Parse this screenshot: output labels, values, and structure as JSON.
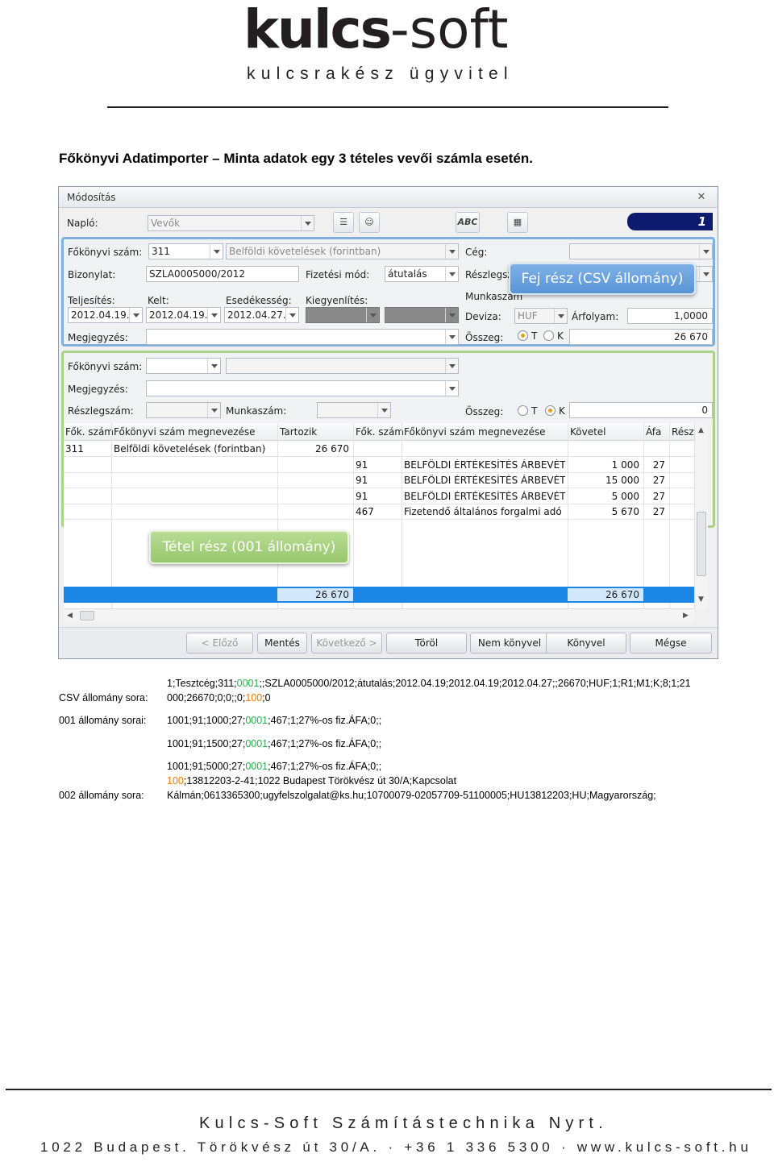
{
  "logo": {
    "brand_bold": "kulcs",
    "brand_light": "-soft",
    "tagline": "kulcsrakész ügyvitel"
  },
  "doc_title": "Főkönyvi Adatimporter – Minta adatok egy 3 tételes vevői számla esetén.",
  "window": {
    "title": "Módosítás",
    "naplo_label": "Napló:",
    "naplo_value": "Vevők",
    "abc_label": "ABC",
    "counter": "1",
    "header": {
      "fokonyvi_szam_label": "Főkönyvi szám:",
      "fokonyvi_szam_value": "311",
      "fokonyvi_szam_name": "Belföldi követelések (forintban)",
      "ceg_label": "Cég:",
      "ceg_value": "",
      "bizonylat_label": "Bizonylat:",
      "bizonylat_value": "SZLA0005000/2012",
      "fizetesi_mod_label": "Fizetési mód:",
      "fizetesi_mod_value": "átutalás",
      "reszlegszam_label": "Részlegsz",
      "teljesites_label": "Teljesítés:",
      "teljesites_value": "2012.04.19.",
      "kelt_label": "Kelt:",
      "kelt_value": "2012.04.19.",
      "esedekesseg_label": "Esedékesség:",
      "esedekesseg_value": "2012.04.27.",
      "kiegyenlites_label": "Kiegyenlítés:",
      "munkaszam_label": "Munkaszám",
      "deviza_label": "Deviza:",
      "deviza_value": "HUF",
      "arfolyam_label": "Árfolyam:",
      "arfolyam_value": "1,0000",
      "megjegyzes_label": "Megjegyzés:",
      "osszeg_label": "Összeg:",
      "osszeg_value": "26 670",
      "radio_t": "T",
      "radio_k": "K"
    },
    "item": {
      "fokonyvi_szam_label": "Főkönyvi szám:",
      "megjegyzes_label": "Megjegyzés:",
      "reszlegszam_label": "Részlegszám:",
      "munkaszam_label": "Munkaszám:",
      "osszeg_label": "Összeg:",
      "osszeg_value": "0",
      "radio_t": "T",
      "radio_k": "K"
    },
    "grid": {
      "columns": [
        "Fők. szám",
        "Főkönyvi szám megnevezése",
        "Tartozik",
        "Fők. szám",
        "Főkönyvi szám megnevezése",
        "Követel",
        "Áfa",
        "Rész"
      ],
      "rows": [
        {
          "fsz1": "311",
          "nev1": "Belföldi követelések (forintban)",
          "tartozik": "26 670",
          "fsz2": "",
          "nev2": "",
          "kovetel": "",
          "afa": ""
        },
        {
          "fsz1": "",
          "nev1": "",
          "tartozik": "",
          "fsz2": "91",
          "nev2": "BELFÖLDI ÉRTÉKESÍTÉS ÁRBEVÉTELE",
          "kovetel": "1 000",
          "afa": "27"
        },
        {
          "fsz1": "",
          "nev1": "",
          "tartozik": "",
          "fsz2": "91",
          "nev2": "BELFÖLDI ÉRTÉKESÍTÉS ÁRBEVÉTELE",
          "kovetel": "15 000",
          "afa": "27"
        },
        {
          "fsz1": "",
          "nev1": "",
          "tartozik": "",
          "fsz2": "91",
          "nev2": "BELFÖLDI ÉRTÉKESÍTÉS ÁRBEVÉTELE",
          "kovetel": "5 000",
          "afa": "27"
        },
        {
          "fsz1": "",
          "nev1": "",
          "tartozik": "",
          "fsz2": "467",
          "nev2": "Fizetendő általános forgalmi adó",
          "kovetel": "5 670",
          "afa": "27"
        }
      ],
      "sum_tartozik": "26 670",
      "sum_kovetel": "26 670"
    },
    "buttons": [
      "< Előző",
      "Mentés",
      "Következő >",
      "Töröl",
      "Nem könyvel",
      "Könyvel",
      "Mégse"
    ],
    "callout_header": "Fej rész (CSV állomány)",
    "callout_item": "Tétel rész (001 állomány)"
  },
  "csv": {
    "label": "CSV állomány sora:",
    "line1_a": "1;Tesztcég;311;",
    "line1_b": "0001",
    "line1_c": ";;SZLA0005000/2012;átutalás;2012.04.19;2012.04.19;2012.04.27;;26670;HUF;1;R1;M1;K;8;1;21",
    "line2_a": "000;26670;0;0;;0;",
    "line2_b": "100",
    "line2_c": ";0"
  },
  "f001": {
    "label": "001 állomány sorai:",
    "lines": [
      {
        "a": "1001;91;1000;27;",
        "b": "0001",
        "c": ";467;1;27%-os fiz.ÁFA;0;;"
      },
      {
        "a": "1001;91;1500;27;",
        "b": "0001",
        "c": ";467;1;27%-os fiz.ÁFA;0;;"
      },
      {
        "a": "1001;91;5000;27;",
        "b": "0001",
        "c": ";467;1;27%-os fiz.ÁFA;0;;"
      }
    ]
  },
  "f002": {
    "label": "002 állomány sora:",
    "line1_a": "100",
    "line1_b": ";13812203-2-41;1022 Budapest Törökvész út 30/A;Kapcsolat",
    "line2": "Kálmán;0613365300;ugyfelszolgalat@ks.hu;10700079-02057709-51100005;HU13812203;HU;Magyarország;"
  },
  "footer": {
    "company": "Kulcs-Soft Számítástechnika Nyrt.",
    "address": "1022 Budapest. Törökvész út 30/A.   ·   +36 1 336 5300   ·   www.kulcs-soft.hu"
  },
  "colors": {
    "green_highlight": "#22b14c",
    "orange_highlight": "#f07c00",
    "selection_blue": "#1c86e6"
  }
}
